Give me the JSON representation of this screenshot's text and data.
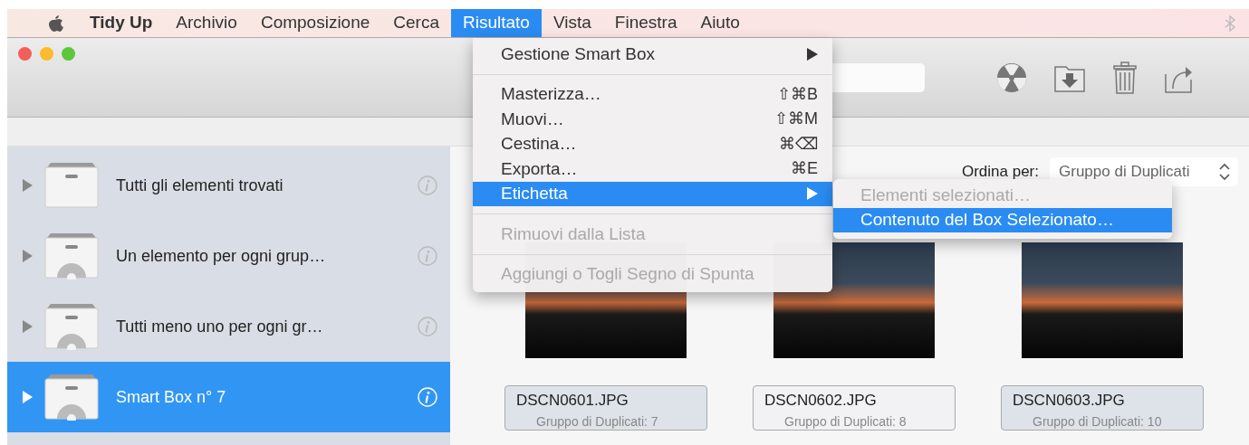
{
  "menu_bar": {
    "items": [
      {
        "label": "Tidy Up",
        "kind": "app",
        "selected": false
      },
      {
        "label": "Archivio",
        "kind": "menu",
        "selected": false
      },
      {
        "label": "Composizione",
        "kind": "menu",
        "selected": false
      },
      {
        "label": "Cerca",
        "kind": "menu",
        "selected": false
      },
      {
        "label": "Risultato",
        "kind": "menu",
        "selected": true
      },
      {
        "label": "Vista",
        "kind": "menu",
        "selected": false
      },
      {
        "label": "Finestra",
        "kind": "menu",
        "selected": false
      },
      {
        "label": "Aiuto",
        "kind": "menu",
        "selected": false
      }
    ]
  },
  "dropdown_menu": {
    "items": [
      {
        "kind": "item",
        "label": "Gestione Smart Box",
        "submenu": true,
        "disabled": false,
        "selected": false
      },
      {
        "kind": "separator"
      },
      {
        "kind": "item",
        "label": "Masterizza…",
        "shortcut": "⇧⌘B",
        "submenu": false,
        "disabled": false,
        "selected": false
      },
      {
        "kind": "item",
        "label": "Muovi…",
        "shortcut": "⇧⌘M",
        "submenu": false,
        "disabled": false,
        "selected": false
      },
      {
        "kind": "item",
        "label": "Cestina…",
        "shortcut": "⌘⌫",
        "submenu": false,
        "disabled": false,
        "selected": false
      },
      {
        "kind": "item",
        "label": "Exporta…",
        "shortcut": "⌘E",
        "submenu": false,
        "disabled": false,
        "selected": false
      },
      {
        "kind": "item",
        "label": "Etichetta",
        "submenu": true,
        "disabled": false,
        "selected": true
      },
      {
        "kind": "separator"
      },
      {
        "kind": "item",
        "label": "Rimuovi dalla Lista",
        "submenu": false,
        "disabled": true,
        "selected": false
      },
      {
        "kind": "separator"
      },
      {
        "kind": "item",
        "label": "Aggiungi o Togli Segno di Spunta",
        "submenu": false,
        "disabled": true,
        "selected": false
      }
    ]
  },
  "submenu": {
    "items": [
      {
        "label": "Elementi selezionati…",
        "disabled": true,
        "selected": false
      },
      {
        "label": "Contenuto del Box Selezionato…",
        "disabled": false,
        "selected": true
      }
    ]
  },
  "sidebar": {
    "items": [
      {
        "label": "Tutti gli elementi trovati",
        "kind": "plain",
        "selected": false
      },
      {
        "label": "Un elemento per ogni grup…",
        "kind": "smart",
        "selected": false
      },
      {
        "label": "Tutti meno uno per ogni gr…",
        "kind": "smart",
        "selected": false
      },
      {
        "label": "Smart Box n° 7",
        "kind": "smart",
        "selected": true
      }
    ]
  },
  "sort": {
    "label": "Ordina per:",
    "value": "Gruppo di Duplicati"
  },
  "thumbnails": [
    {
      "filename": "DSCN0601.JPG",
      "group": "Gruppo di Duplicati: 7",
      "selected": true
    },
    {
      "filename": "DSCN0602.JPG",
      "group": "Gruppo di Duplicati: 8",
      "selected": false
    },
    {
      "filename": "DSCN0603.JPG",
      "group": "Gruppo di Duplicati: 10",
      "selected": true
    }
  ]
}
